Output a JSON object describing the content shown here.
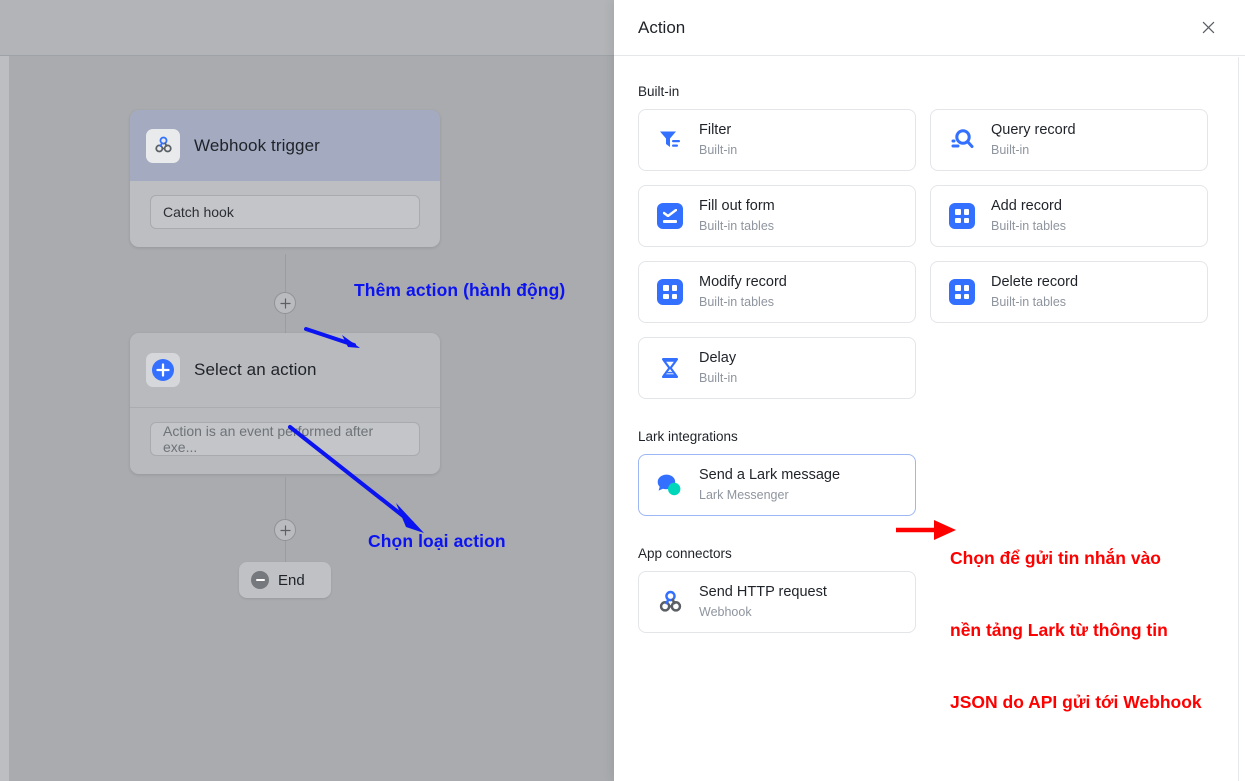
{
  "canvas": {
    "trigger_node": {
      "title": "Webhook trigger",
      "icon": "webhook-icon",
      "field_value": "Catch hook"
    },
    "action_node": {
      "title": "Select an action",
      "icon": "plus-circle-icon",
      "field_placeholder": "Action is an event performed after exe..."
    },
    "end_node": {
      "label": "End",
      "icon": "minus-circle-icon"
    },
    "add_button_label": "+",
    "annotations": [
      {
        "text": "Thêm action (hành động)",
        "color": "#0b13f0"
      },
      {
        "text": "Chọn loại action",
        "color": "#0b13f0"
      }
    ]
  },
  "panel": {
    "title": "Action",
    "close_icon": "close-icon",
    "sections": [
      {
        "title": "Built-in",
        "cards": [
          {
            "label": "Filter",
            "sub": "Built-in",
            "icon": "filter-icon",
            "selected": false
          },
          {
            "label": "Query record",
            "sub": "Built-in",
            "icon": "search-record-icon",
            "selected": false
          },
          {
            "label": "Fill out form",
            "sub": "Built-in tables",
            "icon": "form-check-icon",
            "selected": false
          },
          {
            "label": "Add record",
            "sub": "Built-in tables",
            "icon": "grid-icon",
            "selected": false
          },
          {
            "label": "Modify record",
            "sub": "Built-in tables",
            "icon": "grid-icon",
            "selected": false
          },
          {
            "label": "Delete record",
            "sub": "Built-in tables",
            "icon": "grid-icon",
            "selected": false
          },
          {
            "label": "Delay",
            "sub": "Built-in",
            "icon": "hourglass-icon",
            "selected": false
          }
        ]
      },
      {
        "title": "Lark integrations",
        "cards": [
          {
            "label": "Send a Lark message",
            "sub": "Lark Messenger",
            "icon": "lark-chat-icon",
            "selected": true
          }
        ]
      },
      {
        "title": "App connectors",
        "cards": [
          {
            "label": "Send HTTP request",
            "sub": "Webhook",
            "icon": "webhook-icon",
            "selected": false
          }
        ]
      }
    ],
    "annotation_red": {
      "line1": "Chọn để gửi tin nhắn vào",
      "line2": "nền tảng Lark từ thông tin",
      "line3": "JSON do API gửi tới Webhook",
      "color": "#ff0000"
    }
  },
  "colors": {
    "accent_blue": "#3370ff",
    "annotation_blue": "#0b13f0",
    "annotation_red": "#ff0000",
    "lark_teal": "#00d6b9"
  }
}
